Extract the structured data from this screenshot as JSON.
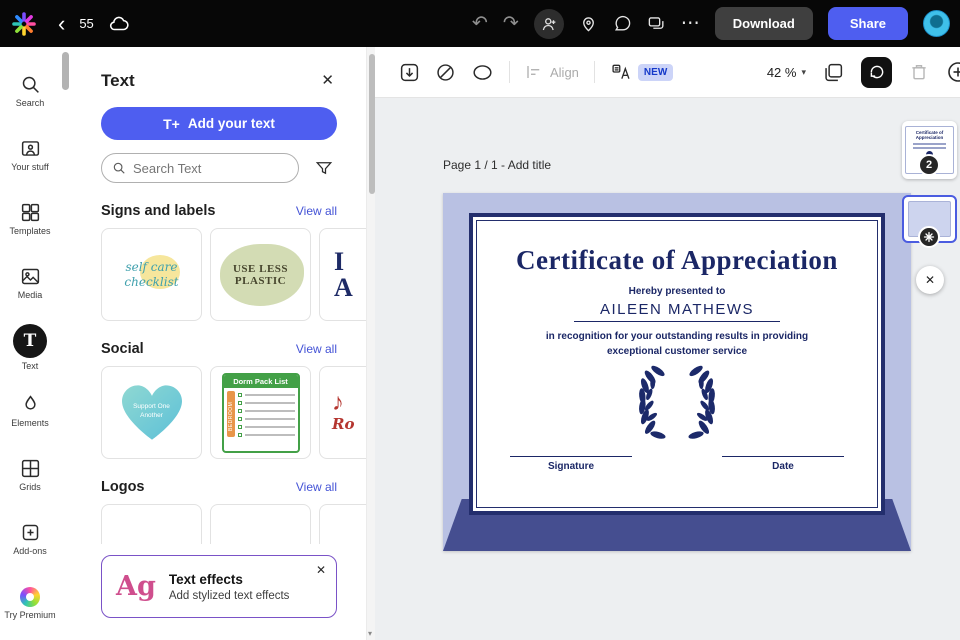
{
  "colors": {
    "accent": "#4e5ef0",
    "topbar_bg": "#070707",
    "download_bg": "#3f3f3f",
    "certificate_navy": "#1b2766",
    "certificate_lavender": "#b9c1e3",
    "certificate_frame": "#454e90",
    "new_badge_bg": "#ccd4f8"
  },
  "icons": {
    "back": "‹",
    "undo": "↶",
    "redo": "↷",
    "more": "⋯",
    "close": "✕",
    "chevron_down": "▾",
    "scroll_down": "▾",
    "text_tool": "T",
    "add_text": "T+",
    "music_note": "♪"
  },
  "topbar": {
    "doc_number": "55",
    "download_label": "Download",
    "share_label": "Share"
  },
  "sidebar": {
    "items": [
      {
        "label": "Search"
      },
      {
        "label": "Your stuff"
      },
      {
        "label": "Templates"
      },
      {
        "label": "Media"
      },
      {
        "label": "Text"
      },
      {
        "label": "Elements"
      },
      {
        "label": "Grids"
      },
      {
        "label": "Add-ons"
      },
      {
        "label": "Try Premium"
      }
    ]
  },
  "panel": {
    "title": "Text",
    "add_button": "Add your text",
    "search_placeholder": "Search Text",
    "sections": [
      {
        "title": "Signs and labels",
        "link": "View all"
      },
      {
        "title": "Social",
        "link": "View all"
      },
      {
        "title": "Logos",
        "link": "View all"
      }
    ],
    "cards": {
      "self_care": "self care\nchecklist",
      "plastic": "USE LESS\nPLASTIC",
      "partial_sign": "I\nA",
      "heart": "Support One\nAnother",
      "dorm_title": "Dorm Pack List",
      "dorm_side": "BEDROOM",
      "partial_social": "Ro"
    },
    "effects": {
      "sample": "Ag",
      "title": "Text effects",
      "subtitle": "Add stylized text effects"
    }
  },
  "toolbar": {
    "align_label": "Align",
    "new_badge": "NEW",
    "zoom_value": "42 %"
  },
  "canvas": {
    "page_label": "Page 1 / 1 - Add title",
    "page_count_badge": "2",
    "certificate": {
      "title": "Certificate of Appreciation",
      "presented_to": "Hereby presented to",
      "recipient": "AILEEN MATHEWS",
      "recognition": "in recognition for your outstanding results in providing\nexceptional customer service",
      "signature_label": "Signature",
      "date_label": "Date"
    }
  }
}
